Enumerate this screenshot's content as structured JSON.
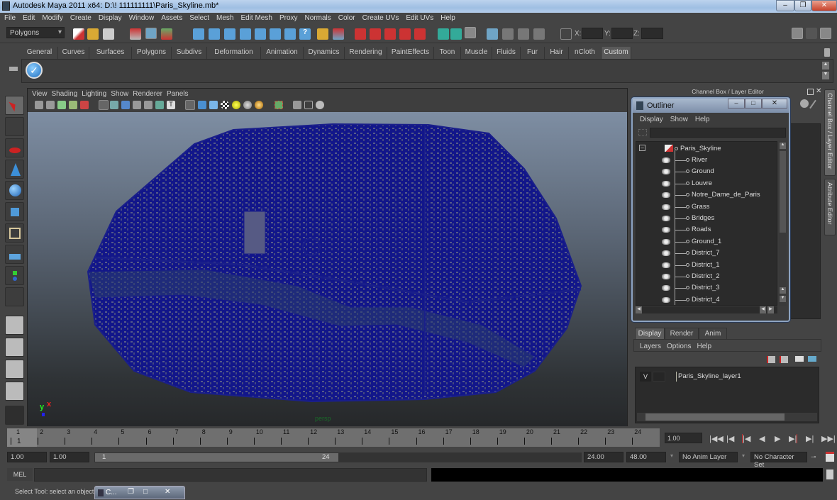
{
  "window": {
    "title": "Autodesk Maya 2011 x64: D:\\! 111111111\\Paris_Skyline.mb*",
    "controls": [
      "minimize",
      "restore",
      "close"
    ]
  },
  "menubar": [
    "File",
    "Edit",
    "Modify",
    "Create",
    "Display",
    "Window",
    "Assets",
    "Select",
    "Mesh",
    "Edit Mesh",
    "Proxy",
    "Normals",
    "Color",
    "Create UVs",
    "Edit UVs",
    "Help"
  ],
  "statusline": {
    "menuset": "Polygons",
    "x_label": "X:",
    "y_label": "Y:",
    "z_label": "Z:",
    "x_value": "",
    "y_value": "",
    "z_value": ""
  },
  "shelf": {
    "tabs": [
      "General",
      "Curves",
      "Surfaces",
      "Polygons",
      "Subdivs",
      "Deformation",
      "Animation",
      "Dynamics",
      "Rendering",
      "PaintEffects",
      "Toon",
      "Muscle",
      "Fluids",
      "Fur",
      "Hair",
      "nCloth",
      "Custom"
    ],
    "active_tab": "Custom"
  },
  "toolbox": [
    "select-tool",
    "lasso-tool",
    "paint-select-tool",
    "move-tool",
    "rotate-tool",
    "scale-tool",
    "universal-manipulator",
    "soft-mod-tool",
    "show-manipulator",
    "last-tool",
    "single-perspective-layout",
    "four-view-layout",
    "outliner-persp-layout",
    "graph-editor-layout"
  ],
  "viewport": {
    "menus": [
      "View",
      "Shading",
      "Lighting",
      "Show",
      "Renderer",
      "Panels"
    ],
    "camera_label": "persp",
    "axis_y": "y",
    "axis_x": "x",
    "wire_color": "#1a1f8a"
  },
  "channelbox": {
    "header": "Channel Box / Layer Editor",
    "side_tabs": [
      "Channel Box / Layer Editor",
      "Attribute Editor"
    ]
  },
  "outliner": {
    "title": "Outliner",
    "menus": [
      "Display",
      "Show",
      "Help"
    ],
    "filter_value": "",
    "root": "Paris_Skyline",
    "children": [
      "River",
      "Ground",
      "Louvre",
      "Notre_Dame_de_Paris",
      "Grass",
      "Bridges",
      "Roads",
      "Ground_1",
      "District_7",
      "District_1",
      "District_2",
      "District_3",
      "District_4"
    ]
  },
  "layer_editor": {
    "tabs": [
      "Display",
      "Render",
      "Anim"
    ],
    "active_tab": "Display",
    "menus": [
      "Layers",
      "Options",
      "Help"
    ],
    "layers": [
      {
        "visible": "V",
        "name": "Paris_Skyline_layer1"
      }
    ]
  },
  "timeline": {
    "ticks": [
      "1",
      "2",
      "3",
      "4",
      "5",
      "6",
      "7",
      "8",
      "9",
      "10",
      "11",
      "12",
      "13",
      "14",
      "15",
      "16",
      "17",
      "18",
      "19",
      "20",
      "21",
      "22",
      "23",
      "24"
    ],
    "current_frame_marker": "1",
    "current_time": "1.00",
    "playback_controls": [
      "go-to-start",
      "step-back-key",
      "step-back-frame",
      "play-backwards",
      "play-forwards",
      "step-forward-frame",
      "step-forward-key",
      "go-to-end"
    ]
  },
  "range": {
    "start_time": "1.00",
    "playback_start": "1.00",
    "slider_start": "1",
    "slider_end": "24",
    "playback_end": "24.00",
    "end_time": "48.00",
    "anim_layer": "No Anim Layer",
    "character_set": "No Character Set"
  },
  "command_line": {
    "label": "MEL",
    "value": "",
    "result": ""
  },
  "status": {
    "help_text": "Select Tool: select an object",
    "minimized_window": "C..."
  }
}
